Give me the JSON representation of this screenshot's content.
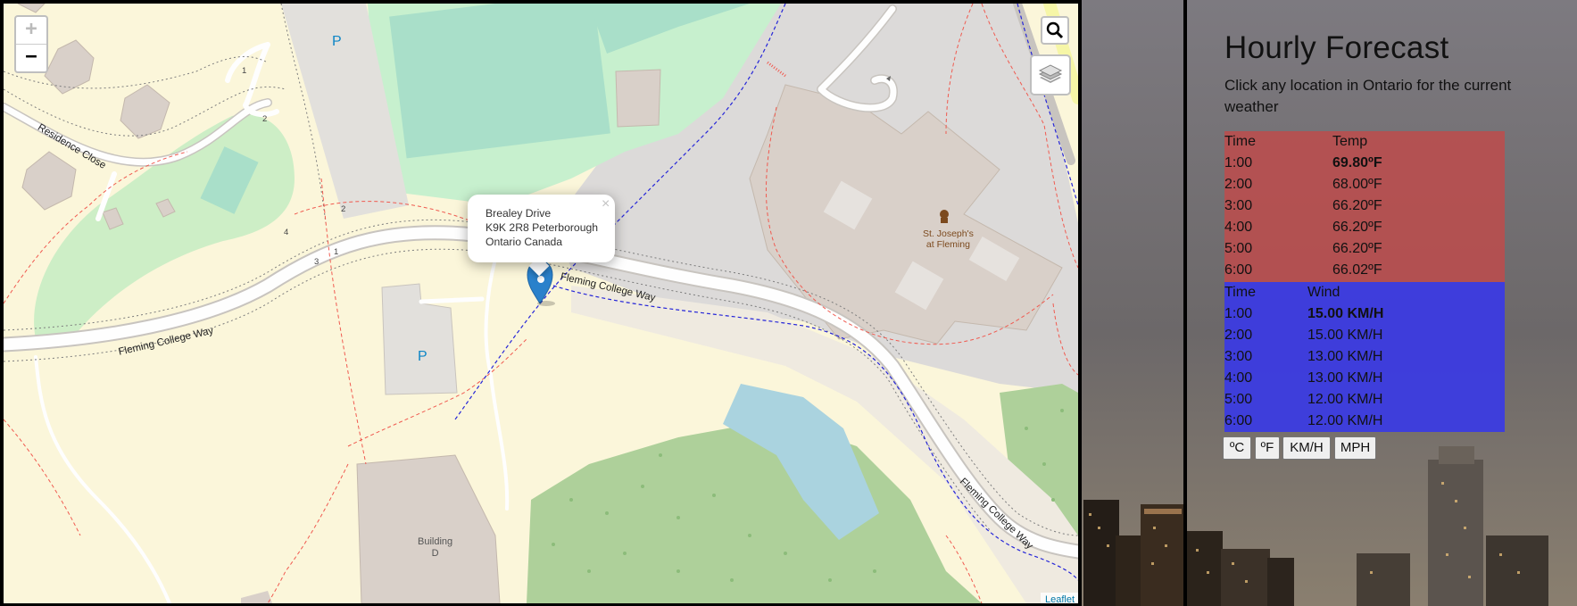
{
  "map": {
    "popup": {
      "line1": "Brealey Drive",
      "line2": "K9K 2R8 Peterborough",
      "line3": "Ontario Canada",
      "close": "×"
    },
    "zoom_in": "+",
    "zoom_out": "−",
    "attribution": "Leaflet",
    "labels": {
      "residence_close": "Residence Close",
      "fleming_college_way_1": "Fleming College Way",
      "fleming_college_way_2": "Fleming College Way",
      "fleming_college_way_3": "Fleming College Way",
      "parking_1": "P",
      "parking_2": "P",
      "building_d": "Building\nD",
      "poi": "St. Joseph's\nat Fleming",
      "house_numbers": [
        "1",
        "2",
        "2",
        "4",
        "3",
        "1"
      ]
    }
  },
  "forecast": {
    "title": "Hourly Forecast",
    "subtitle": "Click any location in Ontario for the current weather",
    "temperature": {
      "headers": [
        "Time",
        "Temp"
      ],
      "rows": [
        {
          "time": "1:00",
          "value": "69.80ºF"
        },
        {
          "time": "2:00",
          "value": "68.00ºF"
        },
        {
          "time": "3:00",
          "value": "66.20ºF"
        },
        {
          "time": "4:00",
          "value": "66.20ºF"
        },
        {
          "time": "5:00",
          "value": "66.20ºF"
        },
        {
          "time": "6:00",
          "value": "66.02ºF"
        }
      ]
    },
    "wind": {
      "headers": [
        "Time",
        "Wind"
      ],
      "rows": [
        {
          "time": "1:00",
          "value": "15.00 KM/H"
        },
        {
          "time": "2:00",
          "value": "15.00 KM/H"
        },
        {
          "time": "3:00",
          "value": "13.00 KM/H"
        },
        {
          "time": "4:00",
          "value": "13.00 KM/H"
        },
        {
          "time": "5:00",
          "value": "12.00 KM/H"
        },
        {
          "time": "6:00",
          "value": "12.00 KM/H"
        }
      ]
    },
    "buttons": {
      "celsius": "ºC",
      "fahrenheit": "ºF",
      "kmh": "KM/H",
      "mph": "MPH"
    }
  },
  "colors": {
    "temp_bg": "#c14b4b",
    "wind_bg": "#3a3ae4",
    "marker": "#2a81cb"
  },
  "icons": [
    "search-icon",
    "layers-icon",
    "map-marker-icon",
    "close-icon"
  ]
}
